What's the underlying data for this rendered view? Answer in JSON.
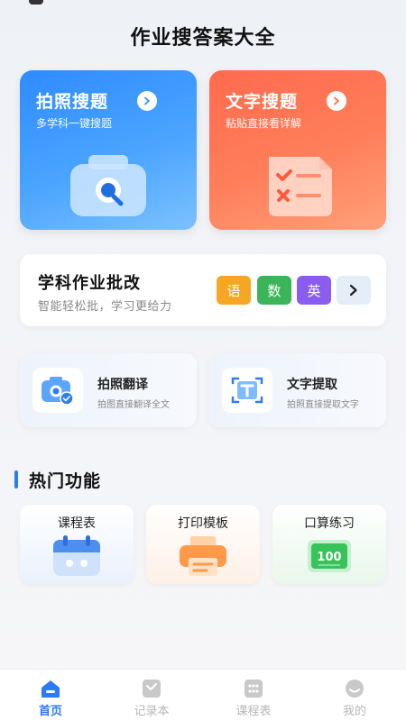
{
  "app": {
    "title": "作业搜答案大全"
  },
  "cards": {
    "photo_search": {
      "title": "拍照搜题",
      "subtitle": "多学科一键搜题"
    },
    "text_search": {
      "title": "文字搜题",
      "subtitle": "粘贴直接看详解"
    }
  },
  "homework": {
    "title": "学科作业批改",
    "subtitle": "智能轻松批，学习更给力",
    "subjects": [
      "语",
      "数",
      "英"
    ]
  },
  "features": {
    "translate": {
      "title": "拍照翻译",
      "subtitle": "拍图直接翻译全文"
    },
    "extract": {
      "title": "文字提取",
      "subtitle": "拍照直接提取文字"
    }
  },
  "hot": {
    "title": "热门功能",
    "items": [
      {
        "label": "课程表"
      },
      {
        "label": "打印模板"
      },
      {
        "label": "口算练习",
        "badge": "100"
      }
    ]
  },
  "nav": {
    "items": [
      {
        "label": "首页"
      },
      {
        "label": "记录本"
      },
      {
        "label": "课程表"
      },
      {
        "label": "我的"
      }
    ]
  },
  "colors": {
    "accent": "#2b7bf5",
    "photo_card": "#3a96ff",
    "text_card": "#ff7457",
    "tag_yu": "#f5a623",
    "tag_shu": "#3cb55a",
    "tag_ying": "#8a5cf0"
  },
  "icons": {
    "photo_search": "camera-search-icon",
    "text_search": "checklist-icon",
    "translate": "camera-translate-icon",
    "extract": "text-scan-icon",
    "timetable": "calendar-icon",
    "print": "printer-icon",
    "arithmetic": "score-board-icon"
  }
}
